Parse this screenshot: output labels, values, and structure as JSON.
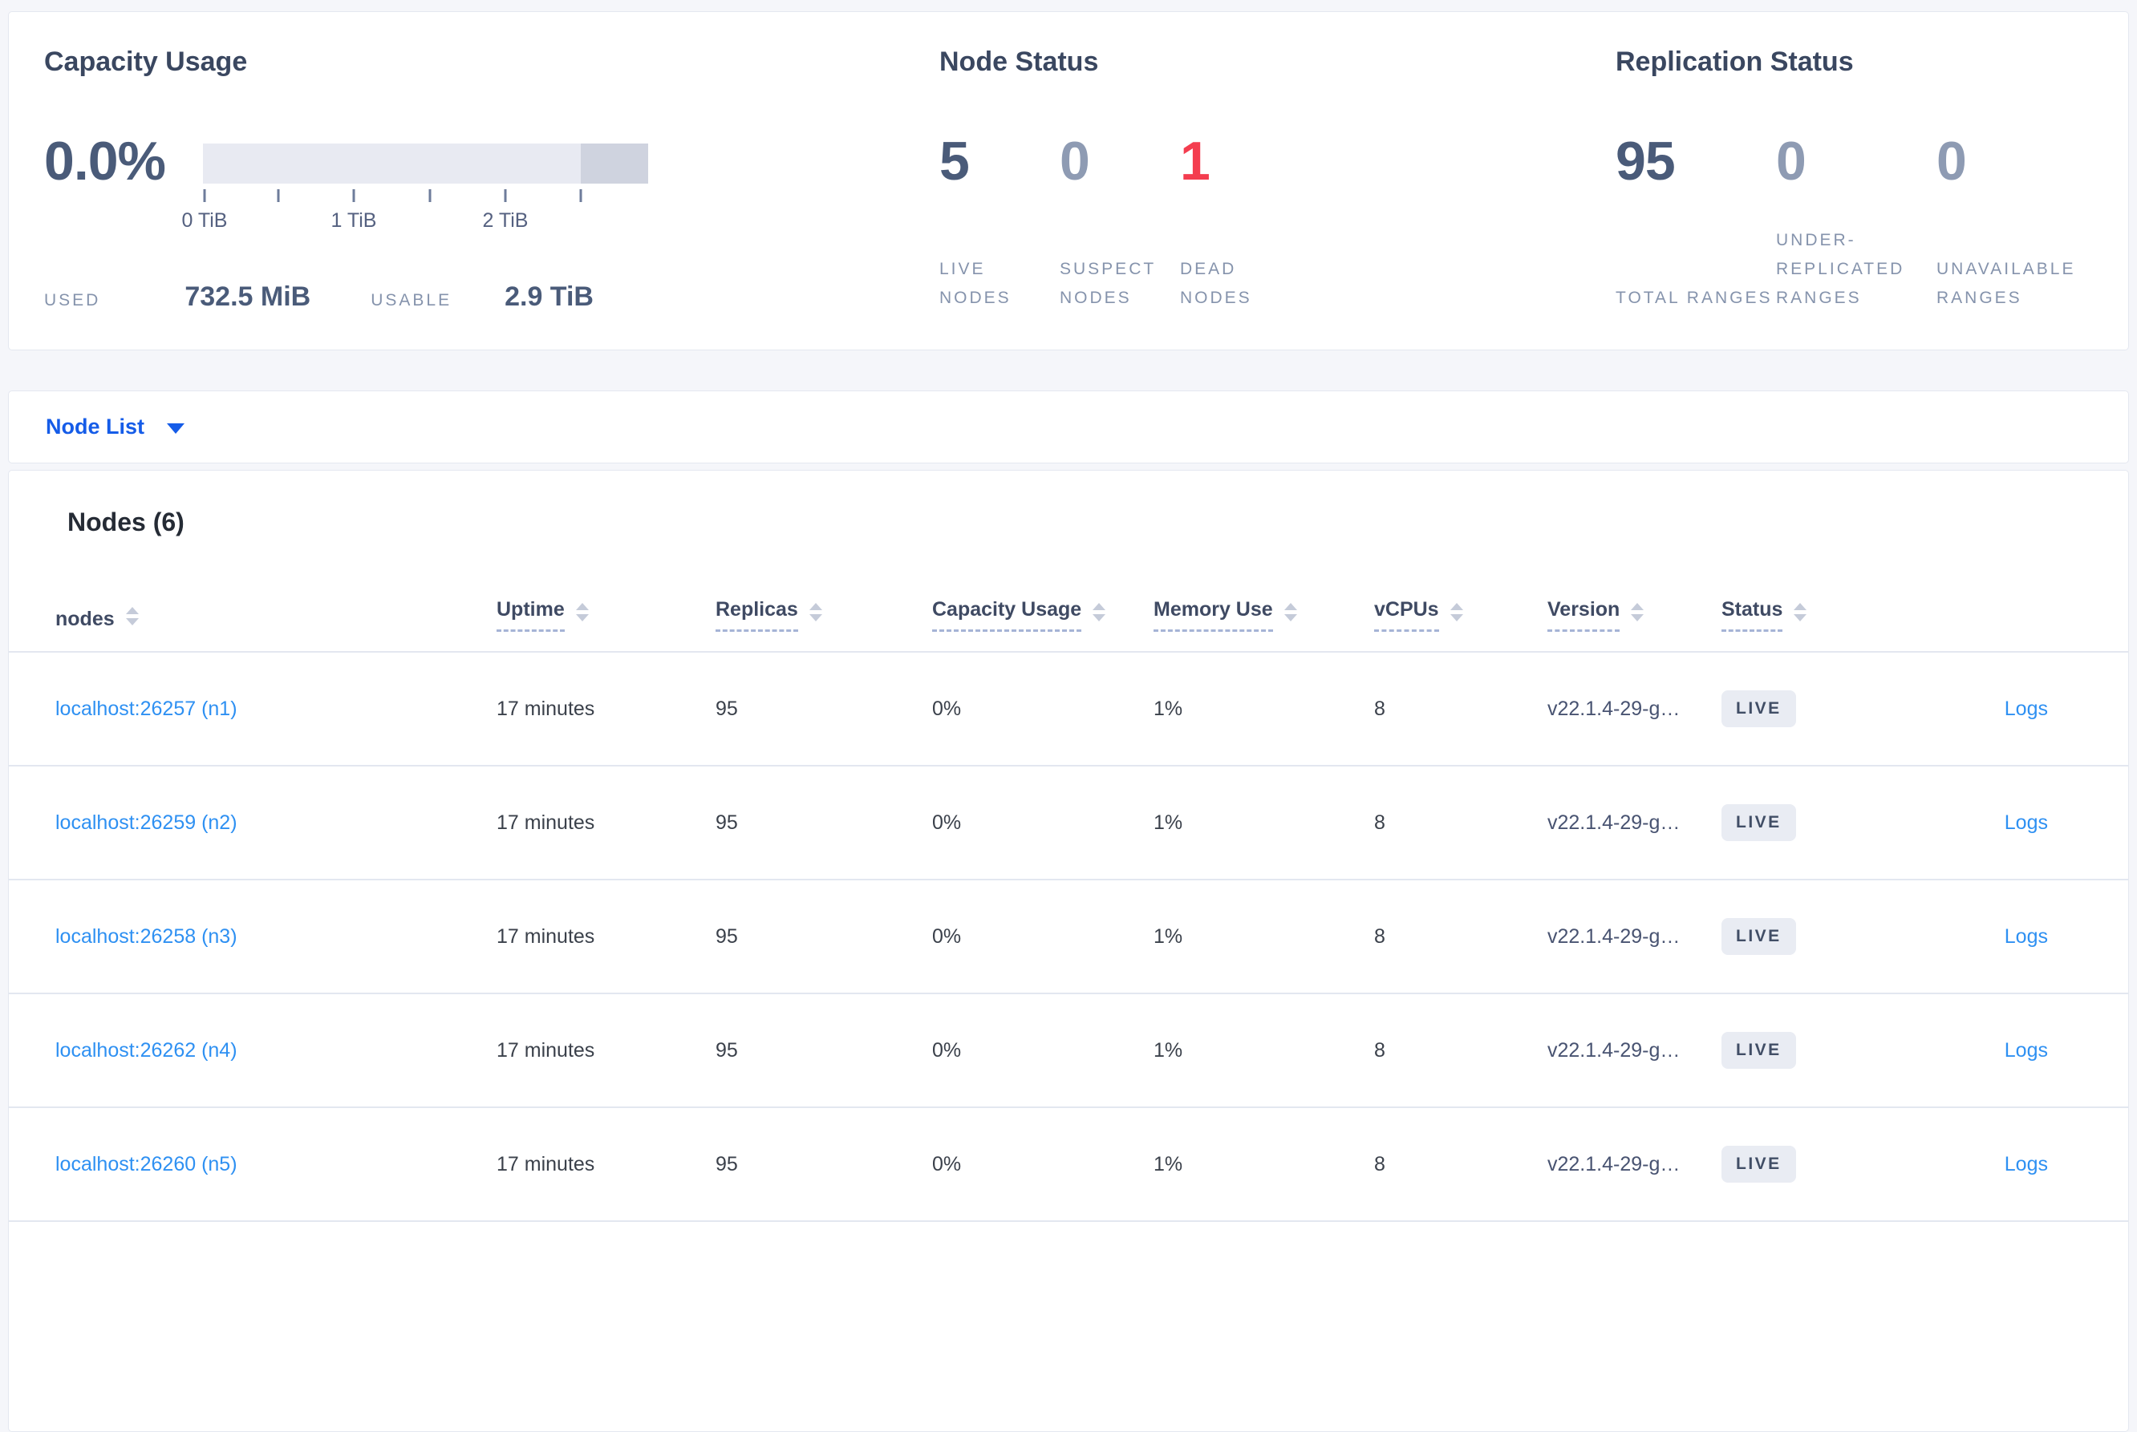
{
  "colors": {
    "accent_blue": "#155ce8",
    "link_blue": "#2e90f2",
    "dead_red": "#f43d4f",
    "stat_dark": "#4a5b79",
    "stat_muted": "#8e9bb3",
    "badge_bg": "#e9ecf3",
    "bar_track": "#e8eaf2",
    "bar_reserved": "#cfd3df"
  },
  "summary": {
    "capacity": {
      "title": "Capacity Usage",
      "percent": "0.0%",
      "ticks": [
        "0 TiB",
        "1 TiB",
        "2 TiB"
      ],
      "used_label": "USED",
      "used_value": "732.5 MiB",
      "usable_label": "USABLE",
      "usable_value": "2.9 TiB"
    },
    "node_status": {
      "title": "Node Status",
      "stats": [
        {
          "value": "5",
          "label": "LIVE NODES",
          "tone": "dark"
        },
        {
          "value": "0",
          "label": "SUSPECT NODES",
          "tone": "muted"
        },
        {
          "value": "1",
          "label": "DEAD NODES",
          "tone": "red"
        }
      ]
    },
    "replication": {
      "title": "Replication Status",
      "stats": [
        {
          "value": "95",
          "label": "TOTAL RANGES",
          "tone": "dark"
        },
        {
          "value": "0",
          "label": "UNDER-REPLICATED RANGES",
          "tone": "muted"
        },
        {
          "value": "0",
          "label": "UNAVAILABLE RANGES",
          "tone": "muted"
        }
      ]
    }
  },
  "view_selector": {
    "label": "Node List"
  },
  "nodes_table": {
    "title": "Nodes (6)",
    "columns": [
      {
        "label": "nodes",
        "underlined": false
      },
      {
        "label": "Uptime",
        "underlined": true
      },
      {
        "label": "Replicas",
        "underlined": true
      },
      {
        "label": "Capacity Usage",
        "underlined": true
      },
      {
        "label": "Memory Use",
        "underlined": true
      },
      {
        "label": "vCPUs",
        "underlined": true
      },
      {
        "label": "Version",
        "underlined": true
      },
      {
        "label": "Status",
        "underlined": true
      }
    ],
    "rows": [
      {
        "node": "localhost:26257 (n1)",
        "uptime": "17 minutes",
        "replicas": "95",
        "capacity": "0%",
        "memory": "1%",
        "vcpus": "8",
        "version": "v22.1.4-29-g…",
        "status": "LIVE",
        "logs": "Logs"
      },
      {
        "node": "localhost:26259 (n2)",
        "uptime": "17 minutes",
        "replicas": "95",
        "capacity": "0%",
        "memory": "1%",
        "vcpus": "8",
        "version": "v22.1.4-29-g…",
        "status": "LIVE",
        "logs": "Logs"
      },
      {
        "node": "localhost:26258 (n3)",
        "uptime": "17 minutes",
        "replicas": "95",
        "capacity": "0%",
        "memory": "1%",
        "vcpus": "8",
        "version": "v22.1.4-29-g…",
        "status": "LIVE",
        "logs": "Logs"
      },
      {
        "node": "localhost:26262 (n4)",
        "uptime": "17 minutes",
        "replicas": "95",
        "capacity": "0%",
        "memory": "1%",
        "vcpus": "8",
        "version": "v22.1.4-29-g…",
        "status": "LIVE",
        "logs": "Logs"
      },
      {
        "node": "localhost:26260 (n5)",
        "uptime": "17 minutes",
        "replicas": "95",
        "capacity": "0%",
        "memory": "1%",
        "vcpus": "8",
        "version": "v22.1.4-29-g…",
        "status": "LIVE",
        "logs": "Logs"
      }
    ]
  }
}
